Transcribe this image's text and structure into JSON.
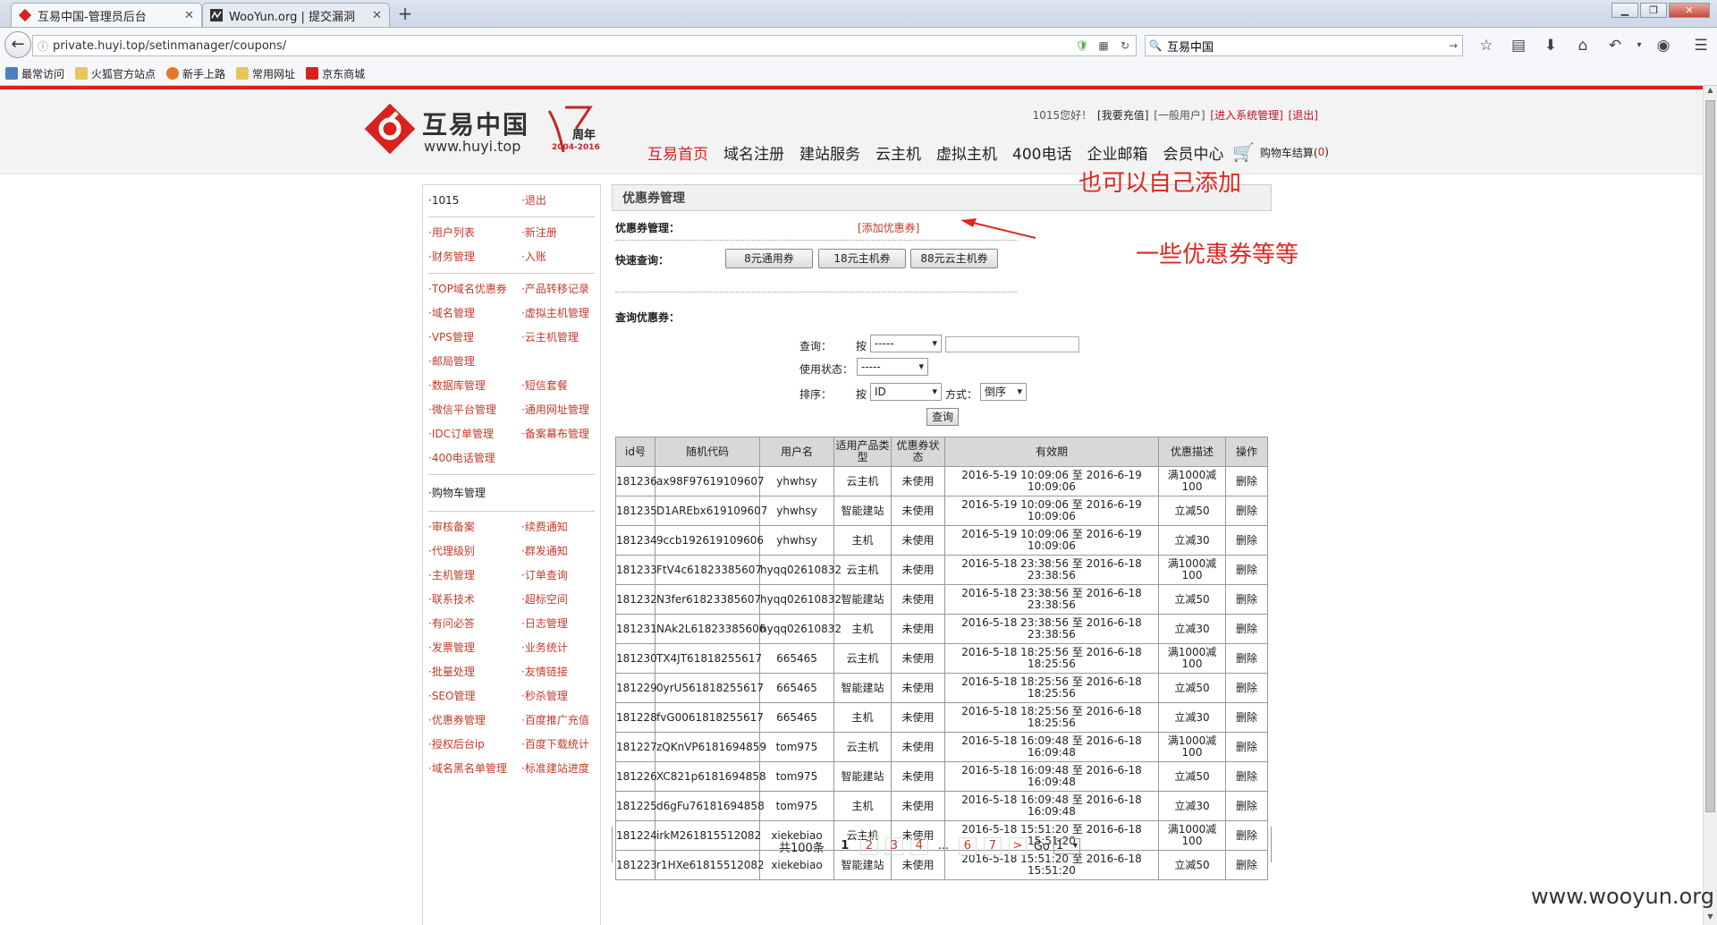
{
  "browser": {
    "tabs": [
      {
        "title": "互易中国-管理员后台",
        "active": true
      },
      {
        "title": "WooYun.org | 提交漏洞",
        "active": false
      }
    ],
    "url": "private.huyi.top/setinmanager/coupons/",
    "search_value": "互易中国",
    "bookmarks": [
      "最常访问",
      "火狐官方站点",
      "新手上路",
      "常用网址",
      "京东商城"
    ]
  },
  "site": {
    "logo_cn": "互易中国",
    "logo_en": "www.huyi.top",
    "anniv_title": "周年",
    "anniv_years": "2004-2016",
    "top_links": {
      "greet": "1015您好！",
      "recharge": "[我要充值]",
      "normal_user": "[一般用户]",
      "sys_manage": "[进入系统管理]",
      "logout": "[退出]"
    },
    "nav": [
      "互易首页",
      "域名注册",
      "建站服务",
      "云主机",
      "虚拟主机",
      "400电话",
      "企业邮箱",
      "会员中心"
    ],
    "cart_label": "购物车结算(",
    "cart_count": "0",
    "cart_close": ")"
  },
  "sidebar": {
    "sec1": [
      "·1015",
      "·退出"
    ],
    "sec2": [
      "·用户列表",
      "·新注册",
      "·财务管理",
      "·入账"
    ],
    "sec3": [
      "·TOP域名优惠券",
      "·产品转移记录",
      "·域名管理",
      "·虚拟主机管理",
      "·VPS管理",
      "·云主机管理",
      "·邮局管理",
      "",
      "·数据库管理",
      "·短信套餐",
      "·微信平台管理",
      "·通用网址管理",
      "·IDC订单管理",
      "·备案幕布管理",
      "·400电话管理",
      ""
    ],
    "sec4_head": "·购物车管理",
    "sec5": [
      "·审核备案",
      "·续费通知",
      "·代理级别",
      "·群发通知",
      "·主机管理",
      "·订单查询",
      "·联系技术",
      "·超标空间",
      "·有问必答",
      "·日志管理",
      "·发票管理",
      "·业务统计",
      "·批量处理",
      "·友情链接",
      "·SEO管理",
      "·秒杀管理",
      "·优惠券管理",
      "·百度推广充值",
      "·授权后台ip",
      "·百度下载统计",
      "·域名黑名单管理",
      "·标准建站进度"
    ]
  },
  "content": {
    "panel_title": "优惠券管理",
    "section_label": "优惠券管理：",
    "add_link": "[添加优惠券]",
    "quick_label": "快速查询：",
    "quick_buttons": [
      "8元通用券",
      "18元主机券",
      "88元云主机券"
    ],
    "search_header": "查询优惠券：",
    "form": {
      "query_label": "查询：",
      "by": "按",
      "query_select": "-----",
      "status_label": "使用状态：",
      "status_select": "-----",
      "sort_label": "排序：",
      "sort_by": "按",
      "sort_select": "ID",
      "mode_label": "方式：",
      "mode_select": "倒序",
      "submit": "查询"
    },
    "table": {
      "headers": [
        "id号",
        "随机代码",
        "用户名",
        "适用产品类型",
        "优惠券状态",
        "有效期",
        "优惠描述",
        "操作"
      ],
      "rows": [
        [
          "181236",
          "ax98F97619109607",
          "yhwhsy",
          "云主机",
          "未使用",
          "2016-5-19 10:09:06 至 2016-6-19 10:09:06",
          "满1000减100",
          "删除"
        ],
        [
          "181235",
          "D1AREbx619109607",
          "yhwhsy",
          "智能建站",
          "未使用",
          "2016-5-19 10:09:06 至 2016-6-19 10:09:06",
          "立减50",
          "删除"
        ],
        [
          "181234",
          "9ccb192619109606",
          "yhwhsy",
          "主机",
          "未使用",
          "2016-5-19 10:09:06 至 2016-6-19 10:09:06",
          "立减30",
          "删除"
        ],
        [
          "181233",
          "FtV4c61823385607",
          "hyqq02610832",
          "云主机",
          "未使用",
          "2016-5-18 23:38:56 至 2016-6-18 23:38:56",
          "满1000减100",
          "删除"
        ],
        [
          "181232",
          "N3fer61823385607",
          "hyqq02610832",
          "智能建站",
          "未使用",
          "2016-5-18 23:38:56 至 2016-6-18 23:38:56",
          "立减50",
          "删除"
        ],
        [
          "181231",
          "NAk2L61823385606",
          "hyqq02610832",
          "主机",
          "未使用",
          "2016-5-18 23:38:56 至 2016-6-18 23:38:56",
          "立减30",
          "删除"
        ],
        [
          "181230",
          "TX4JT61818255617",
          "665465",
          "云主机",
          "未使用",
          "2016-5-18 18:25:56 至 2016-6-18 18:25:56",
          "满1000减100",
          "删除"
        ],
        [
          "181229",
          "0yrU561818255617",
          "665465",
          "智能建站",
          "未使用",
          "2016-5-18 18:25:56 至 2016-6-18 18:25:56",
          "立减50",
          "删除"
        ],
        [
          "181228",
          "fvG0061818255617",
          "665465",
          "主机",
          "未使用",
          "2016-5-18 18:25:56 至 2016-6-18 18:25:56",
          "立减30",
          "删除"
        ],
        [
          "181227",
          "zQKnVP6181694859",
          "tom975",
          "云主机",
          "未使用",
          "2016-5-18 16:09:48 至 2016-6-18 16:09:48",
          "满1000减100",
          "删除"
        ],
        [
          "181226",
          "XC821p6181694858",
          "tom975",
          "智能建站",
          "未使用",
          "2016-5-18 16:09:48 至 2016-6-18 16:09:48",
          "立减50",
          "删除"
        ],
        [
          "181225",
          "d6gFu76181694858",
          "tom975",
          "主机",
          "未使用",
          "2016-5-18 16:09:48 至 2016-6-18 16:09:48",
          "立减30",
          "删除"
        ],
        [
          "181224",
          "irkM261815512082",
          "xiekebiao",
          "云主机",
          "未使用",
          "2016-5-18 15:51:20 至 2016-6-18 15:51:20",
          "满1000减100",
          "删除"
        ],
        [
          "181223",
          "r1HXe61815512082",
          "xiekebiao",
          "智能建站",
          "未使用",
          "2016-5-18 15:51:20 至 2016-6-18 15:51:20",
          "立减50",
          "删除"
        ]
      ]
    },
    "pager": {
      "total": "共100条",
      "pages": [
        "1",
        "2",
        "3",
        "4",
        "...",
        "6",
        "7",
        ">"
      ],
      "go_label": "Go",
      "go_value": "1"
    }
  },
  "annotations": [
    "也可以自己添加",
    "一些优惠券等等"
  ],
  "watermark": "www.wooyun.org"
}
